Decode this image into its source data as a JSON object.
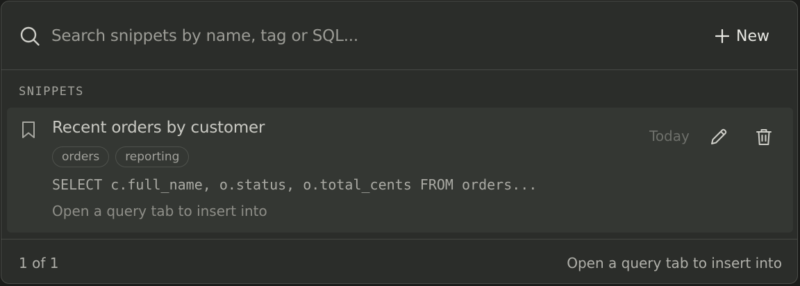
{
  "search": {
    "placeholder": "Search snippets by name, tag or SQL...",
    "icon": "search-icon"
  },
  "header": {
    "new_label": "New",
    "new_icon": "plus-icon"
  },
  "section": {
    "label": "SNIPPETS"
  },
  "snippets": [
    {
      "title": "Recent orders by customer",
      "tags": [
        "orders",
        "reporting"
      ],
      "sql": "SELECT c.full_name, o.status, o.total_cents FROM orders...",
      "hint": "Open a query tab to insert into",
      "date": "Today",
      "icons": {
        "bookmark": "bookmark-icon",
        "edit": "pencil-icon",
        "delete": "trash-icon"
      }
    }
  ],
  "footer": {
    "count": "1 of 1",
    "hint": "Open a query tab to insert into"
  },
  "colors": {
    "panel_bg": "#2b2d2a",
    "row_bg": "#343733",
    "border": "#474945",
    "text_primary": "#e6e6e0",
    "text_muted": "#9c9c96"
  }
}
